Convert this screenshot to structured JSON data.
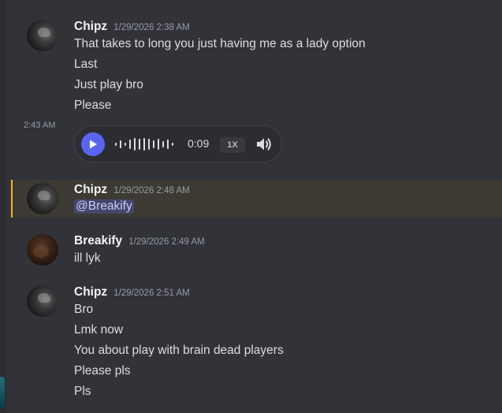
{
  "messages": {
    "group1": {
      "author": "Chipz",
      "timestamp": "1/29/2026 2:38 AM",
      "lines": [
        "That takes to long you just having me as a lady option",
        "Last",
        "Just play bro",
        "Please"
      ],
      "voice_time": "2:43 AM",
      "voice": {
        "duration": "0:09",
        "speed": "1X",
        "play_icon": "play-icon",
        "volume_icon": "volume-icon"
      }
    },
    "group2": {
      "author": "Chipz",
      "timestamp": "1/29/2026 2:48 AM",
      "mention": "@Breakify",
      "highlight_color": "#f0b232"
    },
    "group3": {
      "author": "Breakify",
      "timestamp": "1/29/2026 2:49 AM",
      "lines": [
        "ill lyk"
      ]
    },
    "group4": {
      "author": "Chipz",
      "timestamp": "1/29/2026 2:51 AM",
      "lines": [
        "Bro",
        "Lmk now",
        "You about play with brain dead players",
        "Please pls",
        "Pls"
      ]
    }
  },
  "colors": {
    "background": "#313338",
    "accent": "#5865f2",
    "mention_text": "#c9cdfb"
  }
}
